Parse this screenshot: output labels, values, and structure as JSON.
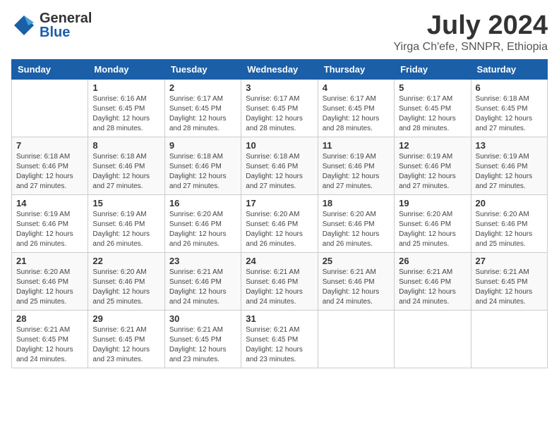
{
  "header": {
    "logo_general": "General",
    "logo_blue": "Blue",
    "title": "July 2024",
    "location": "Yirga Ch'efe, SNNPR, Ethiopia"
  },
  "weekdays": [
    "Sunday",
    "Monday",
    "Tuesday",
    "Wednesday",
    "Thursday",
    "Friday",
    "Saturday"
  ],
  "weeks": [
    [
      {
        "day": "",
        "sunrise": "",
        "sunset": "",
        "daylight": ""
      },
      {
        "day": "1",
        "sunrise": "Sunrise: 6:16 AM",
        "sunset": "Sunset: 6:45 PM",
        "daylight": "Daylight: 12 hours and 28 minutes."
      },
      {
        "day": "2",
        "sunrise": "Sunrise: 6:17 AM",
        "sunset": "Sunset: 6:45 PM",
        "daylight": "Daylight: 12 hours and 28 minutes."
      },
      {
        "day": "3",
        "sunrise": "Sunrise: 6:17 AM",
        "sunset": "Sunset: 6:45 PM",
        "daylight": "Daylight: 12 hours and 28 minutes."
      },
      {
        "day": "4",
        "sunrise": "Sunrise: 6:17 AM",
        "sunset": "Sunset: 6:45 PM",
        "daylight": "Daylight: 12 hours and 28 minutes."
      },
      {
        "day": "5",
        "sunrise": "Sunrise: 6:17 AM",
        "sunset": "Sunset: 6:45 PM",
        "daylight": "Daylight: 12 hours and 28 minutes."
      },
      {
        "day": "6",
        "sunrise": "Sunrise: 6:18 AM",
        "sunset": "Sunset: 6:45 PM",
        "daylight": "Daylight: 12 hours and 27 minutes."
      }
    ],
    [
      {
        "day": "7",
        "sunrise": "Sunrise: 6:18 AM",
        "sunset": "Sunset: 6:46 PM",
        "daylight": "Daylight: 12 hours and 27 minutes."
      },
      {
        "day": "8",
        "sunrise": "Sunrise: 6:18 AM",
        "sunset": "Sunset: 6:46 PM",
        "daylight": "Daylight: 12 hours and 27 minutes."
      },
      {
        "day": "9",
        "sunrise": "Sunrise: 6:18 AM",
        "sunset": "Sunset: 6:46 PM",
        "daylight": "Daylight: 12 hours and 27 minutes."
      },
      {
        "day": "10",
        "sunrise": "Sunrise: 6:18 AM",
        "sunset": "Sunset: 6:46 PM",
        "daylight": "Daylight: 12 hours and 27 minutes."
      },
      {
        "day": "11",
        "sunrise": "Sunrise: 6:19 AM",
        "sunset": "Sunset: 6:46 PM",
        "daylight": "Daylight: 12 hours and 27 minutes."
      },
      {
        "day": "12",
        "sunrise": "Sunrise: 6:19 AM",
        "sunset": "Sunset: 6:46 PM",
        "daylight": "Daylight: 12 hours and 27 minutes."
      },
      {
        "day": "13",
        "sunrise": "Sunrise: 6:19 AM",
        "sunset": "Sunset: 6:46 PM",
        "daylight": "Daylight: 12 hours and 27 minutes."
      }
    ],
    [
      {
        "day": "14",
        "sunrise": "Sunrise: 6:19 AM",
        "sunset": "Sunset: 6:46 PM",
        "daylight": "Daylight: 12 hours and 26 minutes."
      },
      {
        "day": "15",
        "sunrise": "Sunrise: 6:19 AM",
        "sunset": "Sunset: 6:46 PM",
        "daylight": "Daylight: 12 hours and 26 minutes."
      },
      {
        "day": "16",
        "sunrise": "Sunrise: 6:20 AM",
        "sunset": "Sunset: 6:46 PM",
        "daylight": "Daylight: 12 hours and 26 minutes."
      },
      {
        "day": "17",
        "sunrise": "Sunrise: 6:20 AM",
        "sunset": "Sunset: 6:46 PM",
        "daylight": "Daylight: 12 hours and 26 minutes."
      },
      {
        "day": "18",
        "sunrise": "Sunrise: 6:20 AM",
        "sunset": "Sunset: 6:46 PM",
        "daylight": "Daylight: 12 hours and 26 minutes."
      },
      {
        "day": "19",
        "sunrise": "Sunrise: 6:20 AM",
        "sunset": "Sunset: 6:46 PM",
        "daylight": "Daylight: 12 hours and 25 minutes."
      },
      {
        "day": "20",
        "sunrise": "Sunrise: 6:20 AM",
        "sunset": "Sunset: 6:46 PM",
        "daylight": "Daylight: 12 hours and 25 minutes."
      }
    ],
    [
      {
        "day": "21",
        "sunrise": "Sunrise: 6:20 AM",
        "sunset": "Sunset: 6:46 PM",
        "daylight": "Daylight: 12 hours and 25 minutes."
      },
      {
        "day": "22",
        "sunrise": "Sunrise: 6:20 AM",
        "sunset": "Sunset: 6:46 PM",
        "daylight": "Daylight: 12 hours and 25 minutes."
      },
      {
        "day": "23",
        "sunrise": "Sunrise: 6:21 AM",
        "sunset": "Sunset: 6:46 PM",
        "daylight": "Daylight: 12 hours and 24 minutes."
      },
      {
        "day": "24",
        "sunrise": "Sunrise: 6:21 AM",
        "sunset": "Sunset: 6:46 PM",
        "daylight": "Daylight: 12 hours and 24 minutes."
      },
      {
        "day": "25",
        "sunrise": "Sunrise: 6:21 AM",
        "sunset": "Sunset: 6:46 PM",
        "daylight": "Daylight: 12 hours and 24 minutes."
      },
      {
        "day": "26",
        "sunrise": "Sunrise: 6:21 AM",
        "sunset": "Sunset: 6:46 PM",
        "daylight": "Daylight: 12 hours and 24 minutes."
      },
      {
        "day": "27",
        "sunrise": "Sunrise: 6:21 AM",
        "sunset": "Sunset: 6:45 PM",
        "daylight": "Daylight: 12 hours and 24 minutes."
      }
    ],
    [
      {
        "day": "28",
        "sunrise": "Sunrise: 6:21 AM",
        "sunset": "Sunset: 6:45 PM",
        "daylight": "Daylight: 12 hours and 24 minutes."
      },
      {
        "day": "29",
        "sunrise": "Sunrise: 6:21 AM",
        "sunset": "Sunset: 6:45 PM",
        "daylight": "Daylight: 12 hours and 23 minutes."
      },
      {
        "day": "30",
        "sunrise": "Sunrise: 6:21 AM",
        "sunset": "Sunset: 6:45 PM",
        "daylight": "Daylight: 12 hours and 23 minutes."
      },
      {
        "day": "31",
        "sunrise": "Sunrise: 6:21 AM",
        "sunset": "Sunset: 6:45 PM",
        "daylight": "Daylight: 12 hours and 23 minutes."
      },
      {
        "day": "",
        "sunrise": "",
        "sunset": "",
        "daylight": ""
      },
      {
        "day": "",
        "sunrise": "",
        "sunset": "",
        "daylight": ""
      },
      {
        "day": "",
        "sunrise": "",
        "sunset": "",
        "daylight": ""
      }
    ]
  ]
}
